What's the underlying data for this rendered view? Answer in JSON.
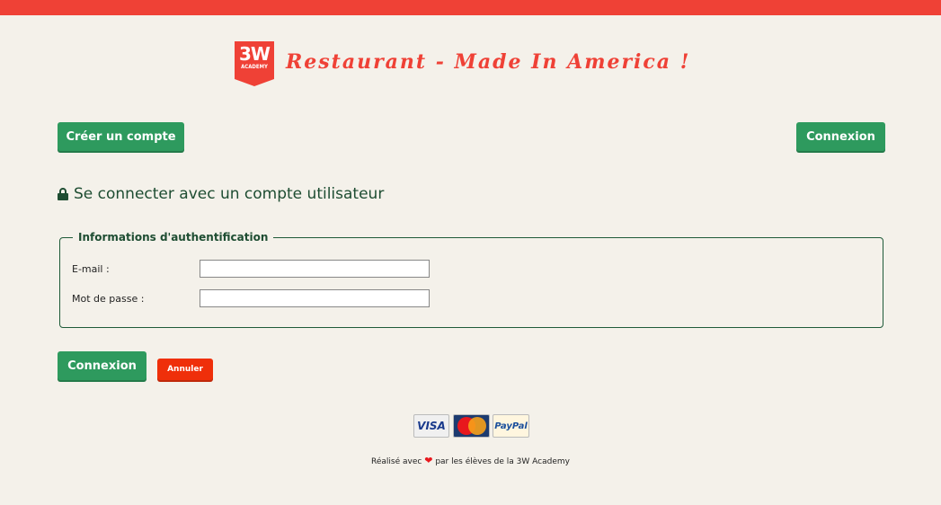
{
  "header": {
    "logo_big": "3W",
    "logo_small": "ACADEMY",
    "title": "Restaurant - Made In America !"
  },
  "nav": {
    "create_account": "Créer un compte",
    "login": "Connexion"
  },
  "page": {
    "heading": "Se connecter avec un compte utilisateur"
  },
  "form": {
    "legend": "Informations d'authentification",
    "email_label": "E-mail :",
    "email_value": "",
    "password_label": "Mot de passe :",
    "password_value": "",
    "submit": "Connexion",
    "cancel": "Annuler"
  },
  "payments": [
    "VISA",
    "MasterCard",
    "PayPal"
  ],
  "footer": {
    "before": "Réalisé avec",
    "heart": "❤",
    "after": " par les élèves de la 3W Academy"
  },
  "colors": {
    "accent_red": "#ef4136",
    "primary_green": "#2e9a5e",
    "heading_green": "#1e4d32",
    "background": "#f4f1ea"
  }
}
